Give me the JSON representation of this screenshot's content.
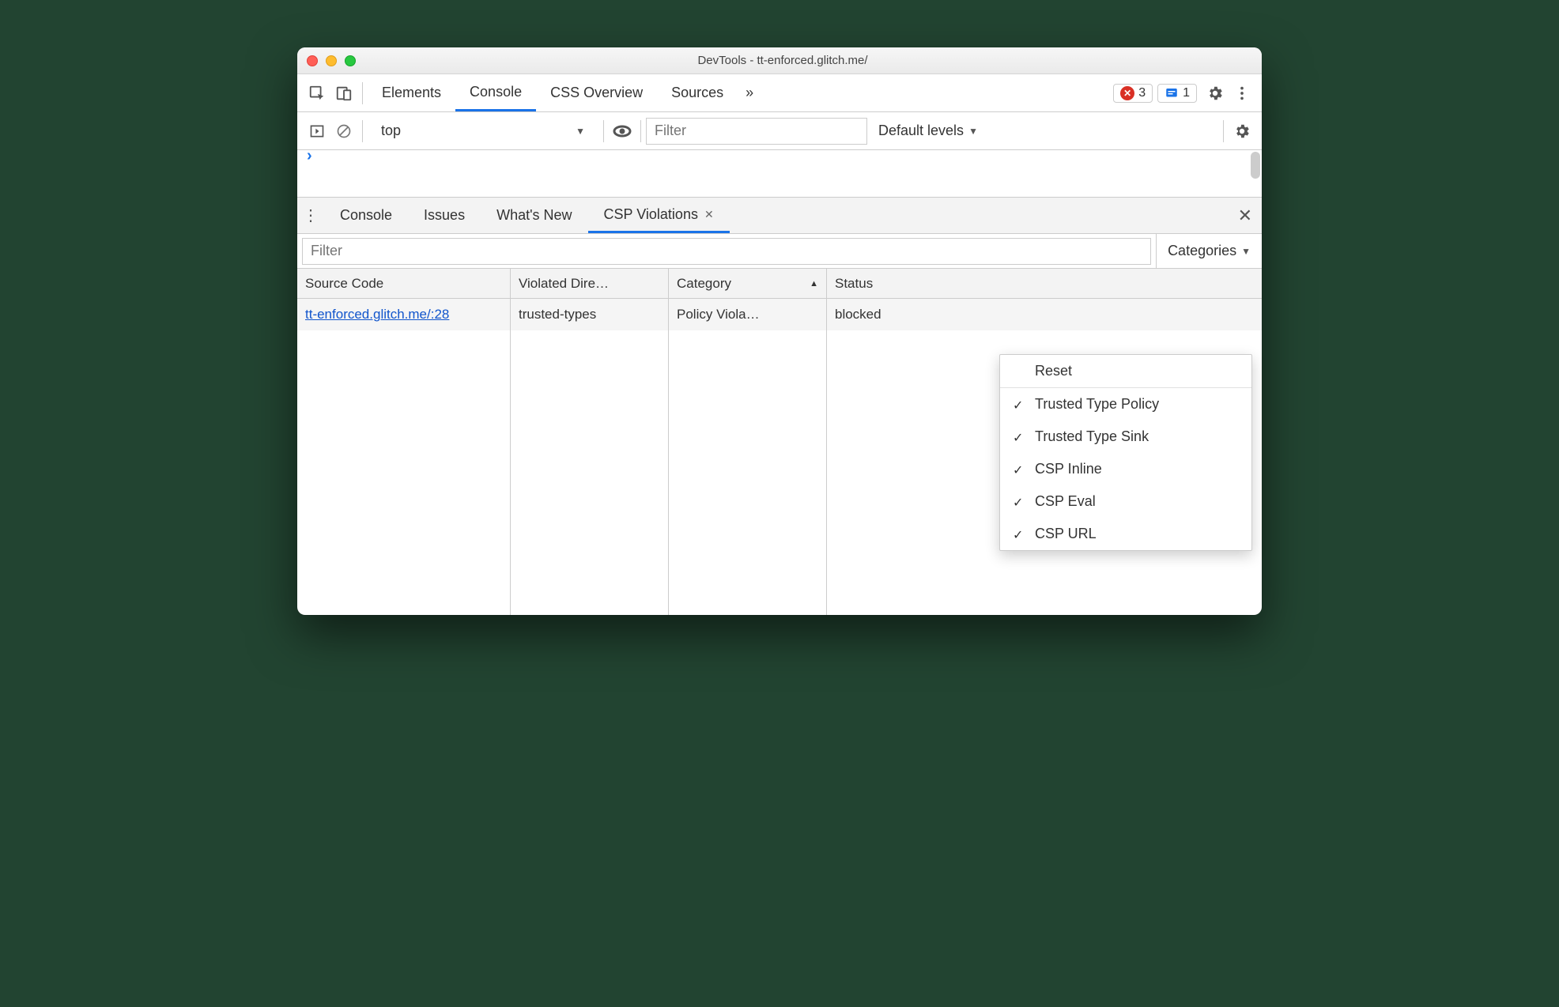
{
  "window": {
    "title": "DevTools - tt-enforced.glitch.me/"
  },
  "main_tabs": {
    "items": [
      "Elements",
      "Console",
      "CSS Overview",
      "Sources"
    ],
    "active": "Console",
    "overflow_glyph": "»"
  },
  "badges": {
    "errors": "3",
    "issues": "1"
  },
  "console_bar": {
    "context": "top",
    "filter_placeholder": "Filter",
    "levels": "Default levels"
  },
  "drawer_tabs": {
    "items": [
      "Console",
      "Issues",
      "What's New",
      "CSP Violations"
    ],
    "active": "CSP Violations"
  },
  "filter_row": {
    "placeholder": "Filter",
    "categories_label": "Categories"
  },
  "table": {
    "headers": {
      "source": "Source Code",
      "directive": "Violated Dire…",
      "category": "Category",
      "status": "Status"
    },
    "rows": [
      {
        "source": "tt-enforced.glitch.me/:28",
        "directive": "trusted-types",
        "category": "Policy Viola…",
        "status": "blocked"
      }
    ]
  },
  "popup": {
    "reset": "Reset",
    "options": [
      "Trusted Type Policy",
      "Trusted Type Sink",
      "CSP Inline",
      "CSP Eval",
      "CSP URL"
    ]
  }
}
